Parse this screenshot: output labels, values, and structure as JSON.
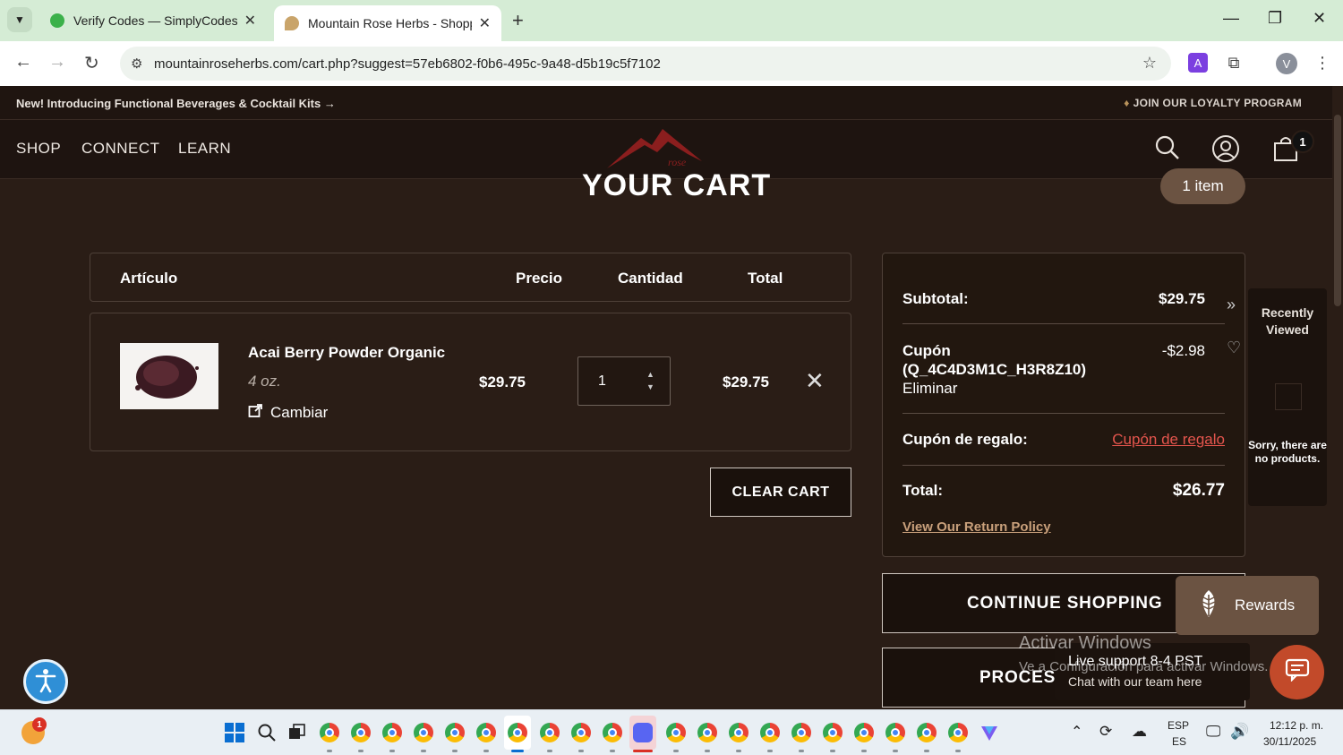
{
  "browser": {
    "tabs": [
      {
        "title": "Verify Codes — SimplyCodes",
        "active": false
      },
      {
        "title": "Mountain Rose Herbs - Shoppin",
        "active": true
      }
    ],
    "url": "mountainroseherbs.com/cart.php?suggest=57eb6802-f0b6-495c-9a48-d5b19c5f7102",
    "profile_initial": "V"
  },
  "promo": {
    "left": "New! Introducing Functional Beverages & Cocktail Kits →",
    "right": "JOIN OUR LOYALTY PROGRAM"
  },
  "nav": {
    "items": [
      "SHOP",
      "CONNECT",
      "LEARN"
    ],
    "logo_text": "rose",
    "cart_count": "1"
  },
  "cart": {
    "title": "YOUR CART",
    "item_count": "1 item",
    "headers": {
      "item": "Artículo",
      "price": "Precio",
      "qty": "Cantidad",
      "total": "Total"
    },
    "items": [
      {
        "name": "Acai Berry Powder Organic",
        "size": "4 oz.",
        "change": "Cambiar",
        "price": "$29.75",
        "qty": "1",
        "total": "$29.75"
      }
    ],
    "clear_label": "CLEAR CART"
  },
  "summary": {
    "subtotal_label": "Subtotal:",
    "subtotal": "$29.75",
    "coupon_label": "Cupón",
    "coupon_code": "(Q_4C4D3M1C_H3R8Z10)",
    "coupon_remove": "Eliminar",
    "coupon_amount": "-$2.98",
    "gift_label": "Cupón de regalo:",
    "gift_link": "Cupón de regalo",
    "total_label": "Total:",
    "total": "$26.77",
    "return_policy": "View Our Return Policy"
  },
  "buttons": {
    "continue": "CONTINUE SHOPPING",
    "process": "PROCES"
  },
  "recently_viewed": {
    "title": "Recently Viewed",
    "empty": "Sorry, there are no products."
  },
  "widgets": {
    "rewards": "Rewards",
    "live_support_title": "Live support 8-4 PST",
    "live_support_sub": "Chat with our team here",
    "watermark_title": "Activar Windows",
    "watermark_sub": "Ve a Configuración para activar Windows."
  },
  "taskbar": {
    "lang1": "ESP",
    "lang2": "ES",
    "time": "12:12 p. m.",
    "date": "30/11/2025",
    "weather_badge": "1"
  },
  "colors": {
    "page_bg": "#2a1d16",
    "accent_brown": "#6b5342",
    "link_red": "#e4554d",
    "return_policy": "#c9a07b"
  }
}
